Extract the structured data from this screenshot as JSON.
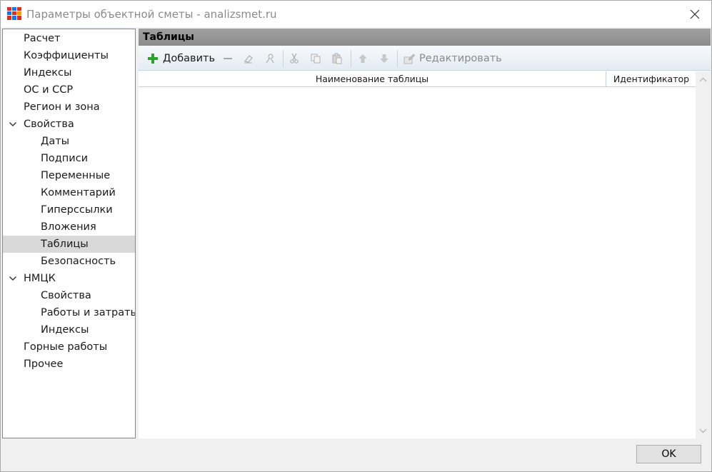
{
  "window": {
    "title": "Параметры объектной сметы - analizsmet.ru"
  },
  "tree": {
    "items": [
      {
        "label": "Расчет",
        "level": 0,
        "expanded": null,
        "selected": false
      },
      {
        "label": "Коэффициенты",
        "level": 0,
        "expanded": null,
        "selected": false
      },
      {
        "label": "Индексы",
        "level": 0,
        "expanded": null,
        "selected": false
      },
      {
        "label": "ОС и ССР",
        "level": 0,
        "expanded": null,
        "selected": false
      },
      {
        "label": "Регион и зона",
        "level": 0,
        "expanded": null,
        "selected": false
      },
      {
        "label": "Свойства",
        "level": 0,
        "expanded": true,
        "selected": false
      },
      {
        "label": "Даты",
        "level": 1,
        "expanded": null,
        "selected": false
      },
      {
        "label": "Подписи",
        "level": 1,
        "expanded": null,
        "selected": false
      },
      {
        "label": "Переменные",
        "level": 1,
        "expanded": null,
        "selected": false
      },
      {
        "label": "Комментарий",
        "level": 1,
        "expanded": null,
        "selected": false
      },
      {
        "label": "Гиперссылки",
        "level": 1,
        "expanded": null,
        "selected": false
      },
      {
        "label": "Вложения",
        "level": 1,
        "expanded": null,
        "selected": false
      },
      {
        "label": "Таблицы",
        "level": 1,
        "expanded": null,
        "selected": true
      },
      {
        "label": "Безопасность",
        "level": 1,
        "expanded": null,
        "selected": false
      },
      {
        "label": "НМЦК",
        "level": 0,
        "expanded": true,
        "selected": false
      },
      {
        "label": "Свойства",
        "level": 1,
        "expanded": null,
        "selected": false
      },
      {
        "label": "Работы и затраты",
        "level": 1,
        "expanded": null,
        "selected": false
      },
      {
        "label": "Индексы",
        "level": 1,
        "expanded": null,
        "selected": false
      },
      {
        "label": "Горные работы",
        "level": 0,
        "expanded": null,
        "selected": false
      },
      {
        "label": "Прочее",
        "level": 0,
        "expanded": null,
        "selected": false
      }
    ]
  },
  "panel": {
    "title": "Таблицы"
  },
  "toolbar": {
    "add_label": "Добавить",
    "edit_label": "Редактировать"
  },
  "grid": {
    "columns": [
      "Наименование таблицы",
      "Идентификатор"
    ],
    "rows": []
  },
  "footer": {
    "ok_label": "OK"
  },
  "colors": {
    "panel_header": "#8c8c8c",
    "toolbar_bg": "#e4ebf3",
    "selected_item": "#d9d9d9",
    "add_icon": "#2ea02e"
  }
}
